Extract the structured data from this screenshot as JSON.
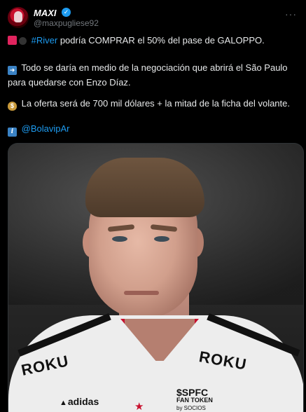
{
  "header": {
    "name": "MAXI",
    "handle": "@maxpugliese92",
    "more_label": "···"
  },
  "tweet": {
    "line1": {
      "hashtag": "#River",
      "text": " podría COMPRAR el 50% del pase de GALOPPO."
    },
    "line2": {
      "text": "Todo se daría en medio de la negociación que abrirá el São Paulo para quedarse con Enzo Díaz."
    },
    "line3": {
      "text": "La oferta será de 700 mil dólares + la mitad de la ficha del volante."
    },
    "line4": {
      "mention": "@BolavipAr"
    }
  },
  "media": {
    "sponsor_left": "ROKU",
    "sponsor_right": "ROKU",
    "brand": "adidas",
    "token_line1": "$SPFC",
    "token_line2": "FAN TOKEN",
    "token_line3": "by SOCIOS"
  },
  "icons": {
    "verified": "verified-badge-icon",
    "siren": "siren-emoji-icon",
    "bomb": "bomb-emoji-icon",
    "arrow": "right-arrow-emoji-icon",
    "money": "money-bag-emoji-icon",
    "info": "info-emoji-icon"
  },
  "colors": {
    "link": "#1d9bf0",
    "background": "#000000",
    "text": "#e7e9ea",
    "secondary": "#71767b"
  }
}
